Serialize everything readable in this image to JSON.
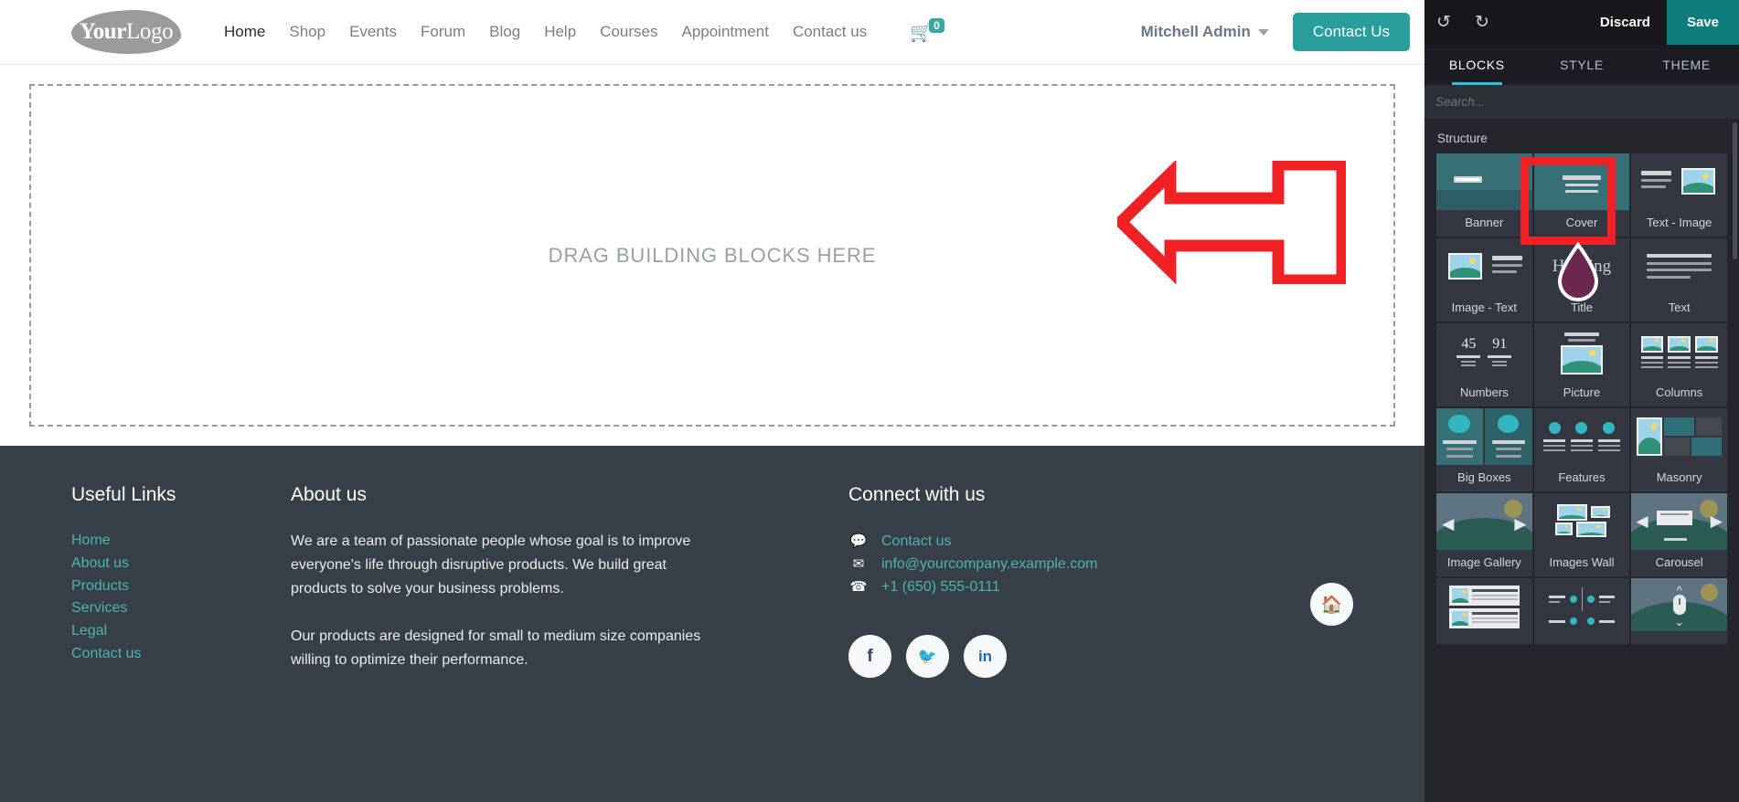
{
  "site": {
    "logo": {
      "first": "Your",
      "second": "Logo"
    },
    "nav": [
      {
        "label": "Home",
        "active": true
      },
      {
        "label": "Shop",
        "active": false
      },
      {
        "label": "Events",
        "active": false
      },
      {
        "label": "Forum",
        "active": false
      },
      {
        "label": "Blog",
        "active": false
      },
      {
        "label": "Help",
        "active": false
      },
      {
        "label": "Courses",
        "active": false
      },
      {
        "label": "Appointment",
        "active": false
      },
      {
        "label": "Contact us",
        "active": false
      }
    ],
    "cart": {
      "icon": "shopping-cart-icon",
      "count": "0",
      "accent": "#3aa6a6"
    },
    "user": {
      "name": "Mitchell Admin"
    },
    "cta": {
      "label": "Contact Us",
      "color": "#2a9d9d"
    },
    "dropzone": {
      "text": "DRAG BUILDING BLOCKS HERE"
    }
  },
  "footer": {
    "background": "#373f48",
    "link_color": "#4fb3b3",
    "useful": {
      "heading": "Useful Links",
      "links": [
        "Home",
        "About us",
        "Products",
        "Services",
        "Legal",
        "Contact us"
      ]
    },
    "about": {
      "heading": "About us",
      "p1": "We are a team of passionate people whose goal is to improve everyone's life through disruptive products. We build great products to solve your business problems.",
      "p2": "Our products are designed for small to medium size companies willing to optimize their performance."
    },
    "connect": {
      "heading": "Connect with us",
      "items": [
        {
          "icon": "comment-icon",
          "label": "Contact us"
        },
        {
          "icon": "envelope-icon",
          "label": "info@yourcompany.example.com"
        },
        {
          "icon": "phone-icon",
          "label": "+1 (650) 555-0111"
        }
      ],
      "socials": [
        {
          "icon": "facebook-icon",
          "glyph": "f",
          "color": "#2d4373"
        },
        {
          "icon": "twitter-icon",
          "glyph": "🐦",
          "color": "#4aa9e8"
        },
        {
          "icon": "linkedin-icon",
          "glyph": "in",
          "color": "#1b6ca8"
        }
      ],
      "home_button": {
        "icon": "home-icon",
        "glyph": "🏠"
      }
    }
  },
  "editor": {
    "header": {
      "undo": {
        "icon": "undo-icon",
        "glyph": "↺"
      },
      "redo": {
        "icon": "redo-icon",
        "glyph": "↻"
      },
      "discard_label": "Discard",
      "save_label": "Save",
      "save_color": "#0d7c7c"
    },
    "tabs": [
      {
        "label": "BLOCKS",
        "active": true
      },
      {
        "label": "STYLE",
        "active": false
      },
      {
        "label": "THEME",
        "active": false
      }
    ],
    "search": {
      "placeholder": "Search...",
      "value": ""
    },
    "section_title": "Structure",
    "blocks": [
      {
        "label": "Banner",
        "thumb": "banner"
      },
      {
        "label": "Cover",
        "thumb": "cover",
        "highlighted": true
      },
      {
        "label": "Text - Image",
        "thumb": "text-image"
      },
      {
        "label": "Image - Text",
        "thumb": "image-text"
      },
      {
        "label": "Title",
        "thumb": "title",
        "thumb_text": "Heading"
      },
      {
        "label": "Text",
        "thumb": "text"
      },
      {
        "label": "Numbers",
        "thumb": "numbers",
        "n1": "45",
        "n2": "91"
      },
      {
        "label": "Picture",
        "thumb": "picture"
      },
      {
        "label": "Columns",
        "thumb": "columns"
      },
      {
        "label": "Big Boxes",
        "thumb": "bigboxes"
      },
      {
        "label": "Features",
        "thumb": "features"
      },
      {
        "label": "Masonry",
        "thumb": "masonry"
      },
      {
        "label": "Image Gallery",
        "thumb": "gallery"
      },
      {
        "label": "Images Wall",
        "thumb": "imageswall"
      },
      {
        "label": "Carousel",
        "thumb": "carousel"
      },
      {
        "label": "",
        "thumb": "media-list"
      },
      {
        "label": "",
        "thumb": "comparisons"
      },
      {
        "label": "",
        "thumb": "parallax"
      }
    ],
    "annotations": {
      "arrow": {
        "name": "red-left-arrow",
        "color": "#ef2125",
        "direction": "left"
      },
      "highlight": {
        "name": "red-highlight-box",
        "color": "#ef2125",
        "target": "Cover"
      },
      "cursor": {
        "name": "drag-cursor",
        "color": "#6b2750"
      }
    }
  }
}
